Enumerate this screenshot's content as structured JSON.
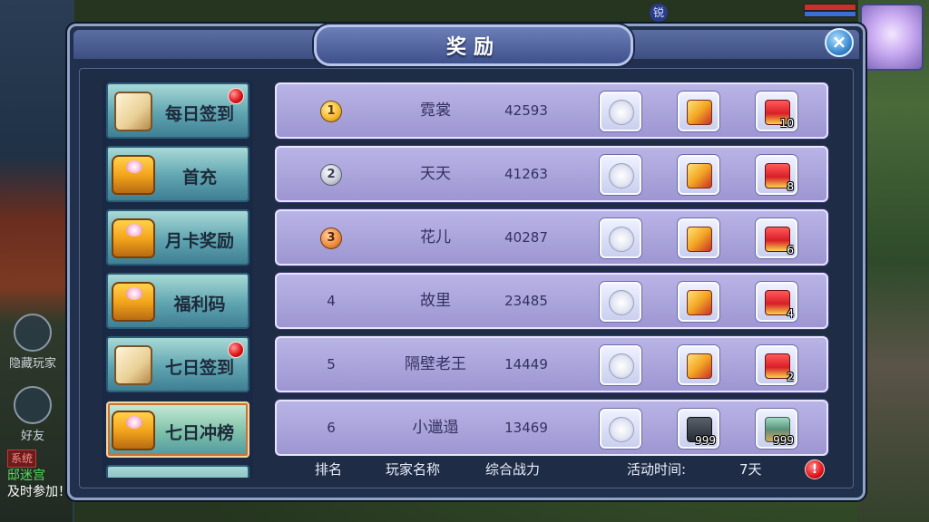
{
  "window": {
    "title": "奖励",
    "close_label": "×"
  },
  "background": {
    "badge": "锐",
    "hide_players": "隐藏玩家",
    "friends": "好友",
    "chat": {
      "tag": "系统",
      "line1": "",
      "line2": "邸迷宫",
      "line3": "及时参加！"
    }
  },
  "menu": {
    "items": [
      {
        "label": "每日签到",
        "icon": "scroll-icon",
        "alert": true
      },
      {
        "label": "首充",
        "icon": "chest-icon",
        "alert": false
      },
      {
        "label": "月卡奖励",
        "icon": "chest-icon",
        "alert": false
      },
      {
        "label": "福利码",
        "icon": "chest-icon",
        "alert": false
      },
      {
        "label": "七日签到",
        "icon": "scroll-icon",
        "alert": true
      },
      {
        "label": "七日冲榜",
        "icon": "chest-icon",
        "alert": false,
        "active": true
      }
    ]
  },
  "rankings": [
    {
      "rank": "1",
      "medal": "gold",
      "name": "霓裳",
      "power": "42593",
      "rewards": [
        {
          "icon": "white-jade-icon",
          "count": ""
        },
        {
          "icon": "gold-scroll-icon",
          "count": ""
        },
        {
          "icon": "red-chest-icon",
          "count": "10"
        }
      ]
    },
    {
      "rank": "2",
      "medal": "silver",
      "name": "天天",
      "power": "41263",
      "rewards": [
        {
          "icon": "white-jade-icon",
          "count": ""
        },
        {
          "icon": "gold-scroll-icon",
          "count": ""
        },
        {
          "icon": "red-chest-icon",
          "count": "8"
        }
      ]
    },
    {
      "rank": "3",
      "medal": "bronze",
      "name": "花儿",
      "power": "40287",
      "rewards": [
        {
          "icon": "white-jade-icon",
          "count": ""
        },
        {
          "icon": "gold-scroll-icon",
          "count": ""
        },
        {
          "icon": "red-chest-icon",
          "count": "6"
        }
      ]
    },
    {
      "rank": "4",
      "medal": "",
      "name": "故里",
      "power": "23485",
      "rewards": [
        {
          "icon": "white-jade-icon",
          "count": ""
        },
        {
          "icon": "gold-scroll-icon",
          "count": ""
        },
        {
          "icon": "red-chest-icon",
          "count": "4"
        }
      ]
    },
    {
      "rank": "5",
      "medal": "",
      "name": "隔壁老王",
      "power": "14449",
      "rewards": [
        {
          "icon": "white-jade-icon",
          "count": ""
        },
        {
          "icon": "gold-scroll-icon",
          "count": ""
        },
        {
          "icon": "red-chest-icon",
          "count": "2"
        }
      ]
    },
    {
      "rank": "6",
      "medal": "",
      "name": "小邋遢",
      "power": "13469",
      "rewards": [
        {
          "icon": "white-jade-icon",
          "count": ""
        },
        {
          "icon": "dark-ore-icon",
          "count": "999"
        },
        {
          "icon": "green-ore-icon",
          "count": "999"
        }
      ]
    }
  ],
  "footer": {
    "rank_header": "排名",
    "name_header": "玩家名称",
    "power_header": "综合战力",
    "time_label": "活动时间:",
    "time_value": "7天",
    "alert_label": "!"
  }
}
